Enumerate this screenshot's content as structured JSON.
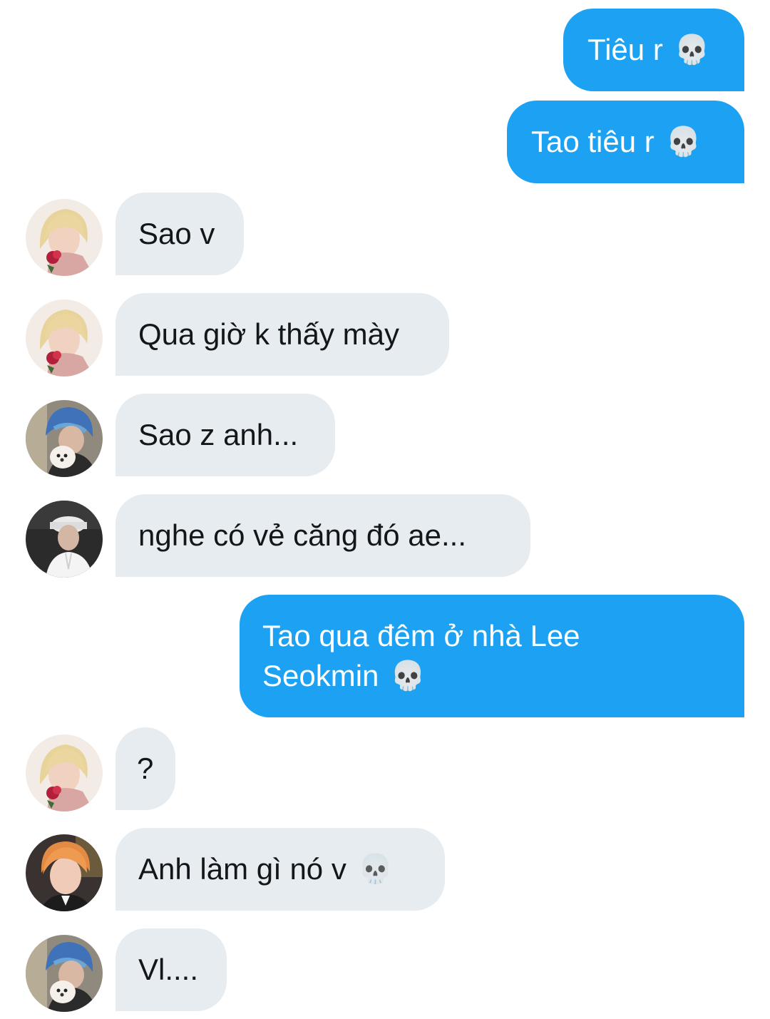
{
  "messages": [
    {
      "dir": "out",
      "text": "Tiêu r",
      "emoji": "💀"
    },
    {
      "dir": "out",
      "text": "Tao tiêu r",
      "emoji": "💀"
    },
    {
      "dir": "in",
      "avatar": "blonde-rose",
      "text": "Sao v"
    },
    {
      "dir": "in",
      "avatar": "blonde-rose",
      "text": "Qua giờ k thấy mày"
    },
    {
      "dir": "in",
      "avatar": "blue-hair-dog",
      "text": "Sao z anh..."
    },
    {
      "dir": "in",
      "avatar": "cap-white-shirt",
      "text": "nghe có vẻ căng đó ae..."
    },
    {
      "dir": "out",
      "line1": "Tao qua đêm ở nhà Lee",
      "line2": "Seokmin",
      "emoji": "💀"
    },
    {
      "dir": "in",
      "avatar": "blonde-rose",
      "text": "?"
    },
    {
      "dir": "in",
      "avatar": "orange-hair-suit",
      "text": "Anh làm gì nó v",
      "emoji": "💀"
    },
    {
      "dir": "in",
      "avatar": "blue-hair-dog",
      "text": "Vl...."
    }
  ],
  "colors": {
    "outgoing": "#1da1f2",
    "incoming": "#e6ecf0",
    "incoming_text": "#14171a"
  }
}
